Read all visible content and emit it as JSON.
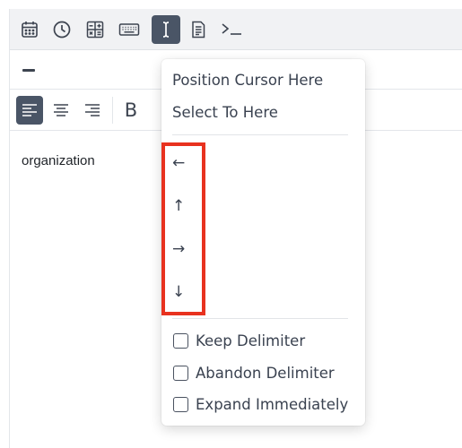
{
  "toolbar": {
    "buttons": [
      {
        "icon": "calendar-icon"
      },
      {
        "icon": "clock-icon"
      },
      {
        "icon": "calculator-icon"
      },
      {
        "icon": "keyboard-icon"
      },
      {
        "icon": "text-cursor-icon",
        "active": true
      },
      {
        "icon": "document-icon"
      },
      {
        "icon": "terminal-icon"
      }
    ]
  },
  "format_toolbar": {
    "align_left_icon": "align-left-icon",
    "align_center_icon": "align-center-icon",
    "align_right_icon": "align-right-icon",
    "bold_label": "B"
  },
  "editor": {
    "text": "organization"
  },
  "context_menu": {
    "position_cursor": "Position Cursor Here",
    "select_to_here": "Select To Here",
    "arrows": {
      "left": "←",
      "up": "↑",
      "right": "→",
      "down": "↓"
    },
    "keep_delimiter": "Keep Delimiter",
    "abandon_delimiter": "Abandon Delimiter",
    "expand_immediately": "Expand Immediately",
    "highlight_color": "#e8321f"
  },
  "colors": {
    "active_button": "#4a5566",
    "toolbar_bg": "#f1f2f4"
  }
}
